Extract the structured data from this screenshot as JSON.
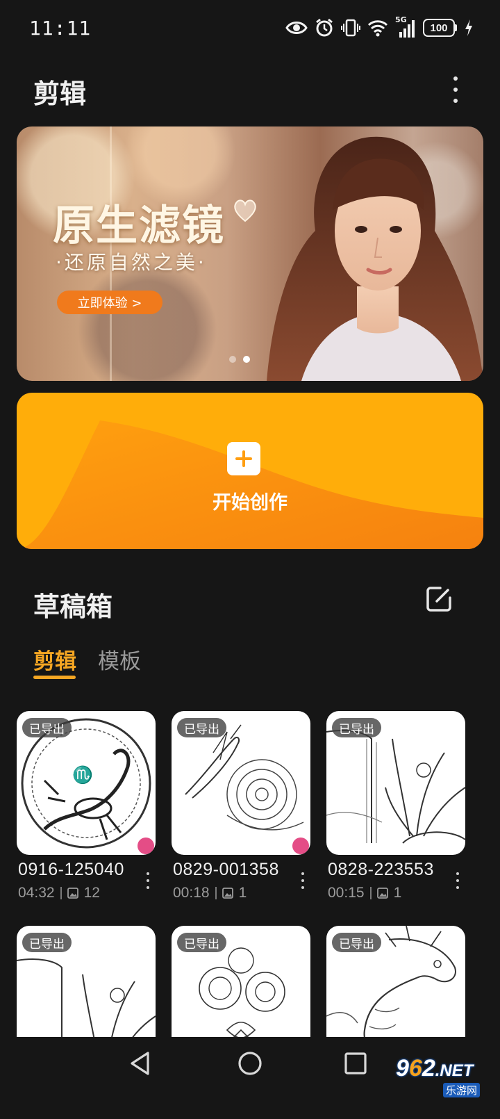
{
  "status_bar": {
    "time": "11:11",
    "network": "5G",
    "battery": "100",
    "icons": [
      "eye-icon",
      "alarm-icon",
      "vibrate-icon",
      "wifi-icon",
      "signal-icon",
      "battery-icon",
      "charging-icon"
    ]
  },
  "header": {
    "title": "剪辑"
  },
  "banner": {
    "heading": "原生滤镜",
    "subheading": "·还原自然之美·",
    "cta": "立即体验 >",
    "dots": 2,
    "active_dot": 1
  },
  "create": {
    "label": "开始创作"
  },
  "drafts": {
    "title": "草稿箱",
    "tabs": [
      {
        "label": "剪辑",
        "active": true
      },
      {
        "label": "模板",
        "active": false
      }
    ],
    "items": [
      {
        "badge": "已导出",
        "name": "0916-125040",
        "duration": "04:32",
        "count": "12",
        "subject": "scorpion"
      },
      {
        "badge": "已导出",
        "name": "0829-001358",
        "duration": "00:18",
        "count": "1",
        "subject": "bird-flowers"
      },
      {
        "badge": "已导出",
        "name": "0828-223553",
        "duration": "00:15",
        "count": "1",
        "subject": "waterfall-plant"
      },
      {
        "badge": "已导出",
        "name": "",
        "duration": "",
        "count": "",
        "subject": "waterfall-plant"
      },
      {
        "badge": "已导出",
        "name": "",
        "duration": "",
        "count": "",
        "subject": "flower-bouquet"
      },
      {
        "badge": "已导出",
        "name": "",
        "duration": "",
        "count": "",
        "subject": "dragon"
      }
    ]
  },
  "watermark": {
    "brand_a": "9",
    "brand_b": "6",
    "brand_c": "2",
    "brand_d": ".NET",
    "sub": "乐游网"
  },
  "colors": {
    "background": "#161616",
    "accent": "#f5a623",
    "create_card": "#ffad0a",
    "cta": "#f07a1c"
  }
}
